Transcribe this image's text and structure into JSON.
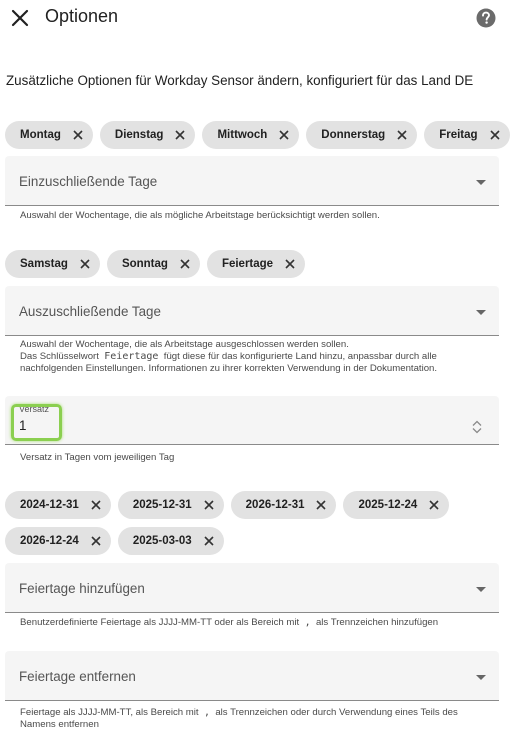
{
  "header": {
    "title": "Optionen",
    "close_icon": "close-icon",
    "help_icon": "help-circle-icon"
  },
  "description": "Zusätzliche Optionen für Workday Sensor ändern, konfiguriert für das Land DE",
  "workdays": {
    "chips": [
      "Montag",
      "Dienstag",
      "Mittwoch",
      "Donnerstag",
      "Freitag"
    ],
    "field_label": "Einzuschließende Tage",
    "helper": "Auswahl der Wochentage, die als mögliche Arbeitstage berücksichtigt werden sollen."
  },
  "excludes": {
    "chips": [
      "Samstag",
      "Sonntag",
      "Feiertage"
    ],
    "field_label": "Auszuschließende Tage",
    "helper_line1": "Auswahl der Wochentage, die als Arbeitstage ausgeschlossen werden sollen.",
    "helper_line2_pre": "Das Schlüsselwort",
    "helper_line2_code": "Feiertage",
    "helper_line2_post": "fügt diese für das konfigurierte Land hinzu, anpassbar durch alle",
    "helper_line3": "nachfolgenden Einstellungen. Informationen zu ihrer korrekten Verwendung in der Dokumentation."
  },
  "offset": {
    "label": "Versatz",
    "value": "1",
    "helper": "Versatz in Tagen vom jeweiligen Tag"
  },
  "add_holidays": {
    "chips": [
      "2024-12-31",
      "2025-12-31",
      "2026-12-31",
      "2025-12-24",
      "2026-12-24",
      "2025-03-03"
    ],
    "field_label": "Feiertage hinzufügen",
    "helper_pre": "Benutzerdefinierte Feiertage als JJJJ-MM-TT oder als Bereich mit",
    "helper_code": ",",
    "helper_post": "als Trennzeichen hinzufügen"
  },
  "remove_holidays": {
    "field_label": "Feiertage entfernen",
    "helper_pre": "Feiertage als JJJJ-MM-TT, als Bereich mit",
    "helper_code": ",",
    "helper_post": "als Trennzeichen oder durch Verwendung eines Teils des",
    "helper_line2": "Namens entfernen"
  },
  "colors": {
    "chip_bg": "#e2e2e2",
    "field_bg": "#f5f5f5",
    "focus_ring": "#8bcf50"
  }
}
